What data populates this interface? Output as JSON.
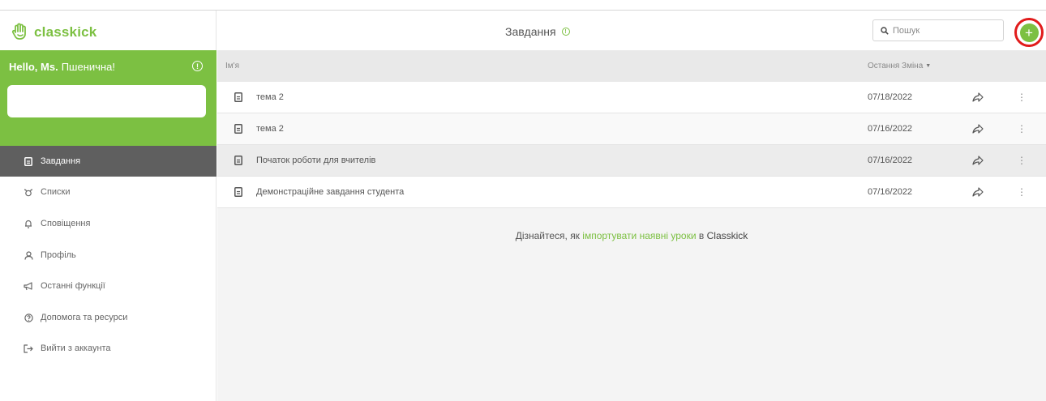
{
  "colors": {
    "brand": "#7cc042",
    "active_nav": "#5f5f5f",
    "highlight_ring": "#e11b1b"
  },
  "app": {
    "logo_text": "classkick"
  },
  "greeting": {
    "hello": "Hello, Ms.",
    "name": "Пшенична!"
  },
  "sidebar": {
    "items": [
      {
        "label": "Завдання",
        "icon": "document-icon",
        "active": true
      },
      {
        "label": "Списки",
        "icon": "roster-icon",
        "active": false
      },
      {
        "label": "Сповіщення",
        "icon": "bell-icon",
        "active": false
      },
      {
        "label": "Профіль",
        "icon": "person-icon",
        "active": false
      },
      {
        "label": "Останні функції",
        "icon": "megaphone-icon",
        "active": false
      },
      {
        "label": "Допомога та ресурси",
        "icon": "help-icon",
        "active": false
      },
      {
        "label": "Вийти з аккаунта",
        "icon": "logout-icon",
        "active": false
      }
    ]
  },
  "header": {
    "title": "Завдання"
  },
  "search": {
    "placeholder": "Пошук"
  },
  "table": {
    "col_name": "Ім'я",
    "col_date": "Остання Зміна",
    "rows": [
      {
        "title": "тема 2",
        "date": "07/18/2022"
      },
      {
        "title": "тема 2",
        "date": "07/16/2022"
      },
      {
        "title": "Початок роботи для вчителів",
        "date": "07/16/2022"
      },
      {
        "title": "Демонстраційне завдання студента",
        "date": "07/16/2022"
      }
    ]
  },
  "import": {
    "prefix": "Дізнайтеся, як",
    "link": "імпортувати наявні уроки",
    "mid": "в",
    "brand": "Classkick"
  }
}
